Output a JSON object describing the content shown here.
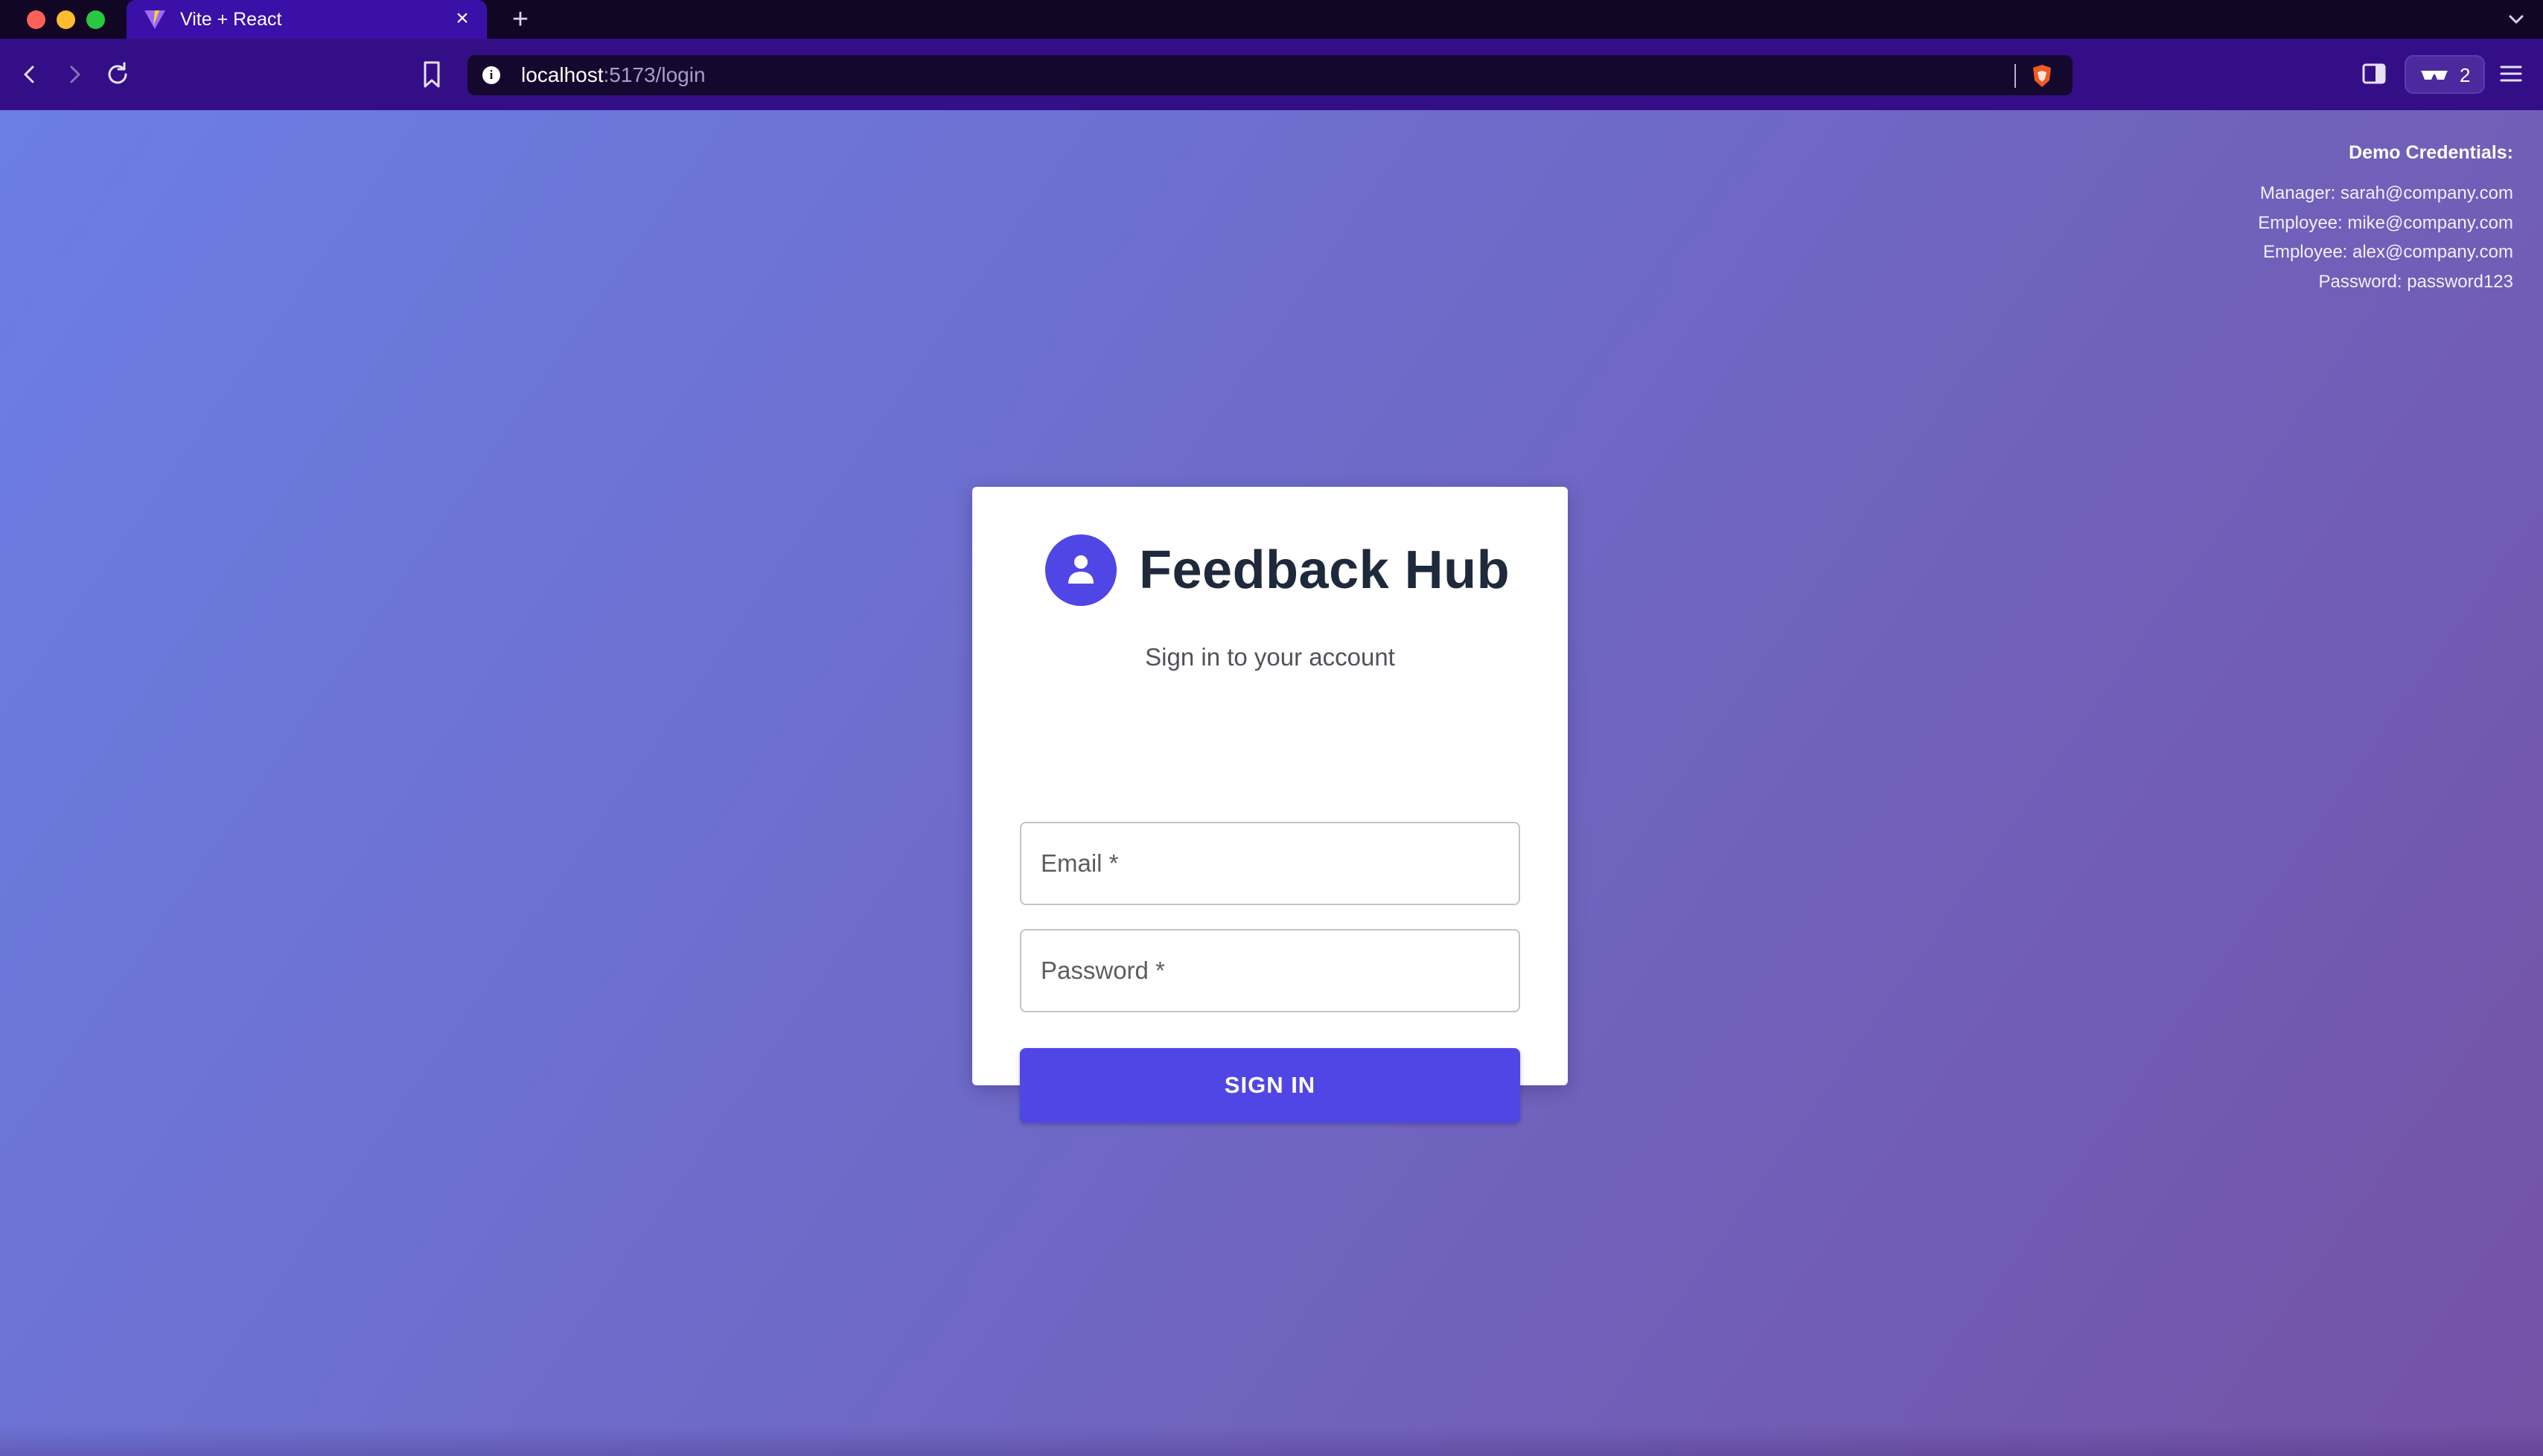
{
  "browser": {
    "tab_title": "Vite + React",
    "url_host": "localhost",
    "url_path": ":5173/login",
    "wallet_count": "2"
  },
  "demo": {
    "title": "Demo Credentials:",
    "lines": [
      "Manager: sarah@company.com",
      "Employee: mike@company.com",
      "Employee: alex@company.com",
      "Password: password123"
    ]
  },
  "login": {
    "app_title": "Feedback Hub",
    "subtitle": "Sign in to your account",
    "email_label": "Email *",
    "password_label": "Password *",
    "submit_label": "SIGN IN"
  },
  "colors": {
    "accent": "#4f46e5",
    "tabstrip": "#120625",
    "toolbar": "#340e87"
  }
}
